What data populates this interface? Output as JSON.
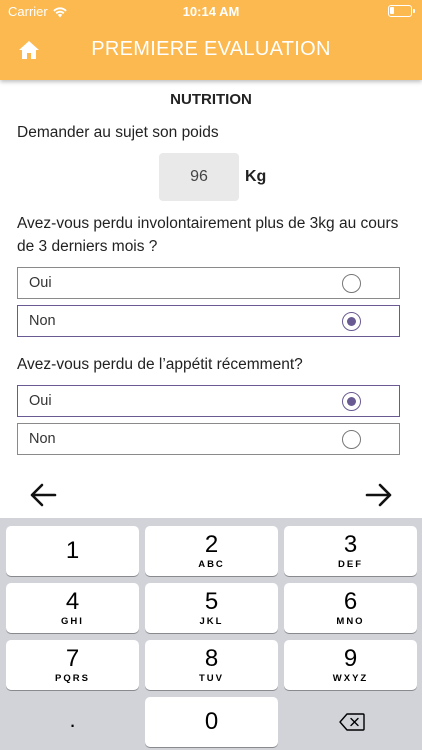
{
  "status_bar": {
    "carrier": "Carrier",
    "time": "10:14 AM"
  },
  "header": {
    "title": "PREMIERE EVALUATION",
    "home_icon": "home-icon"
  },
  "section": {
    "title": "NUTRITION"
  },
  "weight_question": {
    "text": "Demander au sujet son poids",
    "value": "96",
    "unit": "Kg"
  },
  "question_weight_loss": {
    "text": "Avez-vous perdu involontairement plus de 3kg au cours de 3 derniers mois ?",
    "options": [
      {
        "label": "Oui",
        "selected": false
      },
      {
        "label": "Non",
        "selected": true
      }
    ]
  },
  "question_appetite": {
    "text": "Avez-vous perdu de l’appétit récemment?",
    "options": [
      {
        "label": "Oui",
        "selected": true
      },
      {
        "label": "Non",
        "selected": false
      }
    ]
  },
  "navigation": {
    "prev_icon": "arrow-left-icon",
    "next_icon": "arrow-right-icon"
  },
  "keyboard": {
    "keys": [
      {
        "num": "1",
        "letters": ""
      },
      {
        "num": "2",
        "letters": "ABC"
      },
      {
        "num": "3",
        "letters": "DEF"
      },
      {
        "num": "4",
        "letters": "GHI"
      },
      {
        "num": "5",
        "letters": "JKL"
      },
      {
        "num": "6",
        "letters": "MNO"
      },
      {
        "num": "7",
        "letters": "PQRS"
      },
      {
        "num": "8",
        "letters": "TUV"
      },
      {
        "num": "9",
        "letters": "WXYZ"
      }
    ],
    "dot": ".",
    "zero": "0",
    "delete_icon": "backspace-icon"
  },
  "colors": {
    "header": "#fbb950",
    "accent": "#6a5a93",
    "keyboard_bg": "#d1d3d9"
  }
}
